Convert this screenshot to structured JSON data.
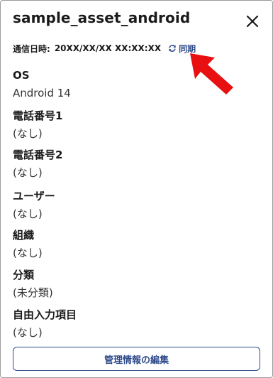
{
  "header": {
    "title": "sample_asset_android",
    "close_icon": "close-icon"
  },
  "sync": {
    "label": "通信日時:",
    "datetime": "20XX/XX/XX XX:XX:XX",
    "link_label": "同期",
    "link_icon": "refresh-icon"
  },
  "annotation": {
    "arrow_color": "#e81010",
    "arrow_icon": "pointer-arrow-icon"
  },
  "fields": [
    {
      "label": "OS",
      "value": "Android 14"
    },
    {
      "label": "電話番号1",
      "value": "(なし)"
    },
    {
      "label": "電話番号2",
      "value": "(なし)"
    },
    {
      "label": "ユーザー",
      "value": "(なし)"
    },
    {
      "label": "組織",
      "value": "(なし)"
    },
    {
      "label": "分類",
      "value": "(未分類)"
    },
    {
      "label": "自由入力項目",
      "value": "(なし)"
    }
  ],
  "footer": {
    "edit_label": "管理情報の編集"
  },
  "colors": {
    "accent": "#2d4a8a",
    "border": "#9a9a9a",
    "arrow": "#e81010"
  }
}
